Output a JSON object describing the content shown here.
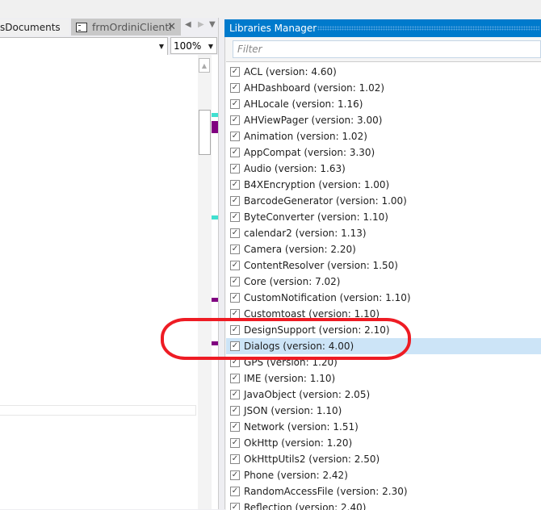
{
  "tabs": [
    {
      "label": "sDocuments"
    },
    {
      "label": "frmOrdiniClienti"
    }
  ],
  "toolbar": {
    "zoom": "100%"
  },
  "panel": {
    "title": "Libraries Manager",
    "filter_placeholder": "Filter"
  },
  "libraries": [
    {
      "label": "ACL (version: 4.60)",
      "checked": true
    },
    {
      "label": "AHDashboard (version: 1.02)",
      "checked": true
    },
    {
      "label": "AHLocale (version: 1.16)",
      "checked": true
    },
    {
      "label": "AHViewPager (version: 3.00)",
      "checked": true
    },
    {
      "label": "Animation (version: 1.02)",
      "checked": true
    },
    {
      "label": "AppCompat (version: 3.30)",
      "checked": true
    },
    {
      "label": "Audio (version: 1.63)",
      "checked": true
    },
    {
      "label": "B4XEncryption (version: 1.00)",
      "checked": true
    },
    {
      "label": "BarcodeGenerator (version: 1.00)",
      "checked": true
    },
    {
      "label": "ByteConverter (version: 1.10)",
      "checked": true
    },
    {
      "label": "calendar2 (version: 1.13)",
      "checked": true
    },
    {
      "label": "Camera (version: 2.20)",
      "checked": true
    },
    {
      "label": "ContentResolver (version: 1.50)",
      "checked": true
    },
    {
      "label": "Core (version: 7.02)",
      "checked": true
    },
    {
      "label": "CustomNotification (version: 1.10)",
      "checked": true
    },
    {
      "label": "Customtoast (version: 1.10)",
      "checked": true
    },
    {
      "label": "DesignSupport (version: 2.10)",
      "checked": true
    },
    {
      "label": "Dialogs (version: 4.00)",
      "checked": true,
      "selected": true
    },
    {
      "label": "GPS (version: 1.20)",
      "checked": true
    },
    {
      "label": "IME (version: 1.10)",
      "checked": true
    },
    {
      "label": "JavaObject (version: 2.05)",
      "checked": true
    },
    {
      "label": "JSON (version: 1.10)",
      "checked": true
    },
    {
      "label": "Network (version: 1.51)",
      "checked": true
    },
    {
      "label": "OkHttp (version: 1.20)",
      "checked": true
    },
    {
      "label": "OkHttpUtils2 (version: 2.50)",
      "checked": true
    },
    {
      "label": "Phone (version: 2.42)",
      "checked": true
    },
    {
      "label": "RandomAccessFile (version: 2.30)",
      "checked": true
    },
    {
      "label": "Reflection (version: 2.40)",
      "checked": true
    }
  ],
  "colors": {
    "accent": "#007acc",
    "annotation": "#ee1c24",
    "marker_cyan": "#40e0d0",
    "marker_purple": "#800080"
  }
}
